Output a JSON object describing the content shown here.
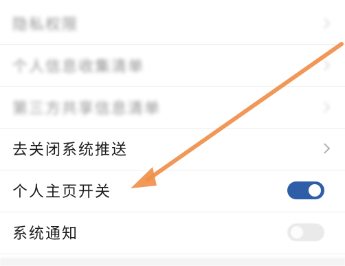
{
  "settings": {
    "items": [
      {
        "label": "隐私权限",
        "blurred": true
      },
      {
        "label": "个人信息收集清单",
        "blurred": true
      },
      {
        "label": "第三方共享信息清单",
        "blurred": true
      },
      {
        "label": "去关闭系统推送"
      },
      {
        "label": "个人主页开关",
        "toggle": "on"
      },
      {
        "label": "系统通知",
        "toggle": "off"
      }
    ]
  },
  "annotation": {
    "arrow_color": "#f0904a",
    "toggle_on_color": "#2f5ea8"
  }
}
